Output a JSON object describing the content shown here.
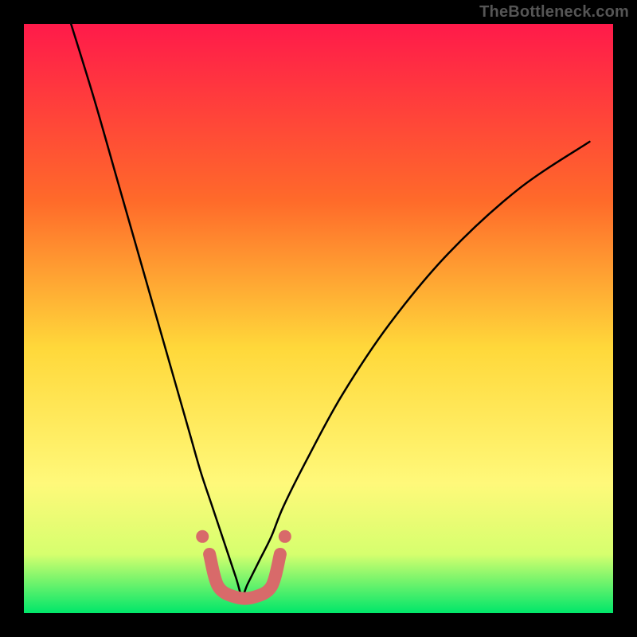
{
  "watermark": "TheBottleneck.com",
  "colors": {
    "background": "#000000",
    "gradient_top": "#ff1a4a",
    "gradient_mid1": "#ff6a2a",
    "gradient_mid2": "#ffd83a",
    "gradient_mid3": "#fff97a",
    "gradient_mid4": "#d6ff6e",
    "gradient_bottom": "#00e66a",
    "curve": "#000000",
    "marker_stroke": "#d86a6a",
    "marker_fill": "#d86a6a"
  },
  "chart_data": {
    "type": "line",
    "title": "",
    "xlabel": "",
    "ylabel": "",
    "xlim": [
      0,
      100
    ],
    "ylim": [
      0,
      100
    ],
    "legend": false,
    "grid": false,
    "description": "V-shaped bottleneck curve over vertical red→yellow→green gradient. Minimum near x≈37. Left branch rises to top-left corner; right branch rises toward upper-right. Pink thick U-shaped marker sits at the valley floor with two small dots at its ends.",
    "series": [
      {
        "name": "bottleneck-curve",
        "x": [
          8,
          12,
          16,
          20,
          24,
          28,
          30,
          32,
          34,
          36,
          37,
          38,
          40,
          42,
          44,
          48,
          54,
          62,
          72,
          84,
          96
        ],
        "y": [
          100,
          87,
          73,
          59,
          45,
          31,
          24,
          18,
          12,
          6,
          3,
          5,
          9,
          13,
          18,
          26,
          37,
          49,
          61,
          72,
          80
        ]
      }
    ],
    "valley_marker": {
      "points_xy": [
        [
          31.5,
          10
        ],
        [
          33,
          4.5
        ],
        [
          36,
          2.7
        ],
        [
          39,
          2.7
        ],
        [
          42,
          4.5
        ],
        [
          43.5,
          10
        ]
      ],
      "dot_left_xy": [
        30.3,
        13
      ],
      "dot_right_xy": [
        44.3,
        13
      ]
    }
  }
}
